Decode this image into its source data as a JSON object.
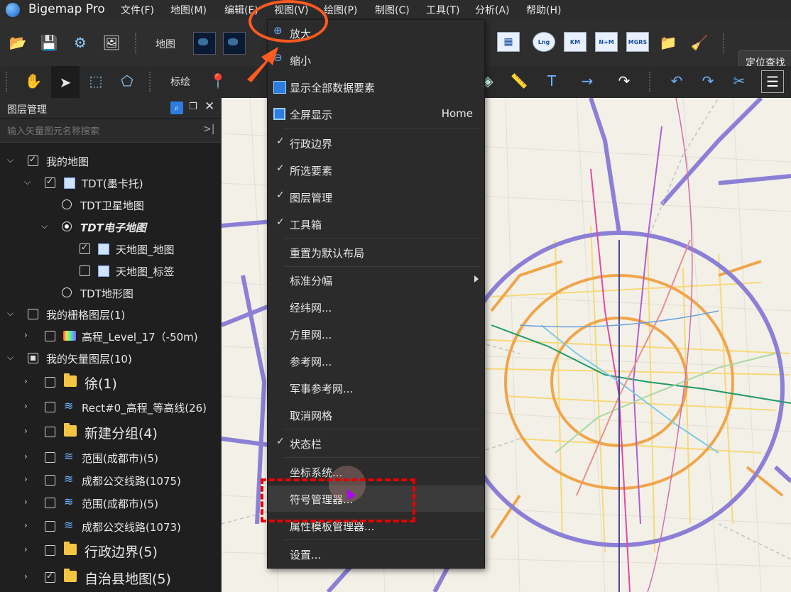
{
  "app": {
    "title": "Bigemap Pro"
  },
  "menubar": {
    "items": [
      "文件(F)",
      "地图(M)",
      "编辑(E)",
      "视图(V)",
      "绘图(P)",
      "制图(C)",
      "工具(T)",
      "分析(A)",
      "帮助(H)"
    ]
  },
  "toolbar1": {
    "map_label": "地图",
    "grid_buttons": [
      "Lng",
      "KM",
      "N+M",
      "MGRS"
    ],
    "locate_label": "定位查找"
  },
  "toolbar2": {
    "annotate_label": "标绘"
  },
  "layer_panel": {
    "title": "图层管理",
    "search_placeholder": "输入矢量图元名称搜索",
    "tree": [
      {
        "label": "我的地图",
        "state": "checked"
      },
      {
        "label": "TDT(墨卡托)",
        "state": "checked"
      },
      {
        "label": "TDT卫星地图",
        "state": "off"
      },
      {
        "label": "TDT电子地图",
        "state": "on"
      },
      {
        "label": "天地图_地图",
        "state": "checked"
      },
      {
        "label": "天地图_标签",
        "state": "unchecked"
      },
      {
        "label": "TDT地形图",
        "state": "off"
      },
      {
        "label": "我的栅格图层(1)",
        "state": "unchecked"
      },
      {
        "label": "高程_Level_17（-50m)",
        "state": "unchecked"
      },
      {
        "label": "我的矢量图层(10)",
        "state": "partial"
      },
      {
        "label": "徐(1)",
        "state": "unchecked"
      },
      {
        "label": "Rect#0_高程_等高线(26)",
        "state": "unchecked"
      },
      {
        "label": "新建分组(4)",
        "state": "unchecked"
      },
      {
        "label": "范围(成都市)(5)",
        "state": "unchecked"
      },
      {
        "label": "成都公交线路(1075)",
        "state": "unchecked"
      },
      {
        "label": "范围(成都市)(5)",
        "state": "unchecked"
      },
      {
        "label": "成都公交线路(1073)",
        "state": "unchecked"
      },
      {
        "label": "行政边界(5)",
        "state": "unchecked"
      },
      {
        "label": "自治县地图(5)",
        "state": "checked"
      }
    ]
  },
  "view_menu": {
    "items": [
      {
        "label": "放大",
        "icon": "zoom-in-icon"
      },
      {
        "label": "缩小",
        "icon": "zoom-out-icon"
      },
      {
        "label": "显示全部数据要素",
        "icon": "extent-icon"
      },
      {
        "label": "全屏显示",
        "icon": "fullscreen-icon",
        "shortcut": "Home"
      },
      {
        "label": "行政边界",
        "checked": true
      },
      {
        "label": "所选要素",
        "checked": true
      },
      {
        "label": "图层管理",
        "checked": true
      },
      {
        "label": "工具箱",
        "checked": true
      },
      {
        "label": "重置为默认布局"
      },
      {
        "label": "标准分幅",
        "submenu": true
      },
      {
        "label": "经纬网..."
      },
      {
        "label": "方里网..."
      },
      {
        "label": "参考网..."
      },
      {
        "label": "军事参考网..."
      },
      {
        "label": "取消网格"
      },
      {
        "label": "状态栏",
        "checked": true
      },
      {
        "label": "坐标系统..."
      },
      {
        "label": "符号管理器...",
        "highlighted": true
      },
      {
        "label": "属性模板管理器..."
      },
      {
        "label": "设置..."
      }
    ]
  },
  "colors": {
    "annotation_circle": "#ff5a1f",
    "annotation_box": "#e60000",
    "road_purple": "#8b7fd6",
    "road_orange": "#f0a54a"
  }
}
